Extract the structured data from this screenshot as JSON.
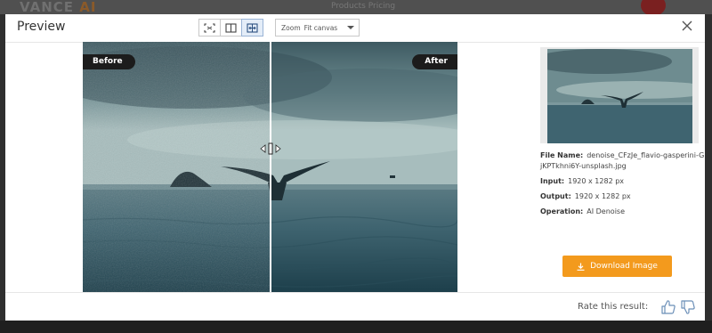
{
  "background": {
    "logo_text": "VANCE",
    "logo_ai": "AI",
    "nav_text": "Products      Pricing"
  },
  "modal": {
    "title": "Preview",
    "close_icon": "close-icon"
  },
  "toolbar": {
    "buttons": [
      {
        "icon": "fit-screen-icon",
        "active": false
      },
      {
        "icon": "side-by-side-icon",
        "active": false
      },
      {
        "icon": "slider-compare-icon",
        "active": true
      }
    ],
    "zoom_label": "Zoom",
    "zoom_value": "Fit canvas",
    "zoom_caret_icon": "chevron-down-icon"
  },
  "compare": {
    "before_label": "Before",
    "after_label": "After",
    "split_position": 0.5,
    "handle_icon": "drag-handle-icon"
  },
  "file_info": {
    "file_name_label": "File Name:",
    "file_name_value": "denoise_CFzJe_flavio-gasperini-GjKPTkhni6Y-unsplash.jpg",
    "input_label": "Input:",
    "input_value": "1920 x 1282 px",
    "output_label": "Output:",
    "output_value": "1920 x 1282 px",
    "operation_label": "Operation:",
    "operation_value": "AI Denoise"
  },
  "download": {
    "label": "Download Image",
    "icon": "download-icon"
  },
  "rating": {
    "label": "Rate this result:",
    "up_icon": "thumbs-up-icon",
    "down_icon": "thumbs-down-icon"
  },
  "colors": {
    "accent": "#f39a1d",
    "badge": "#1c1c1c",
    "active_tool": "#e4edf8"
  }
}
